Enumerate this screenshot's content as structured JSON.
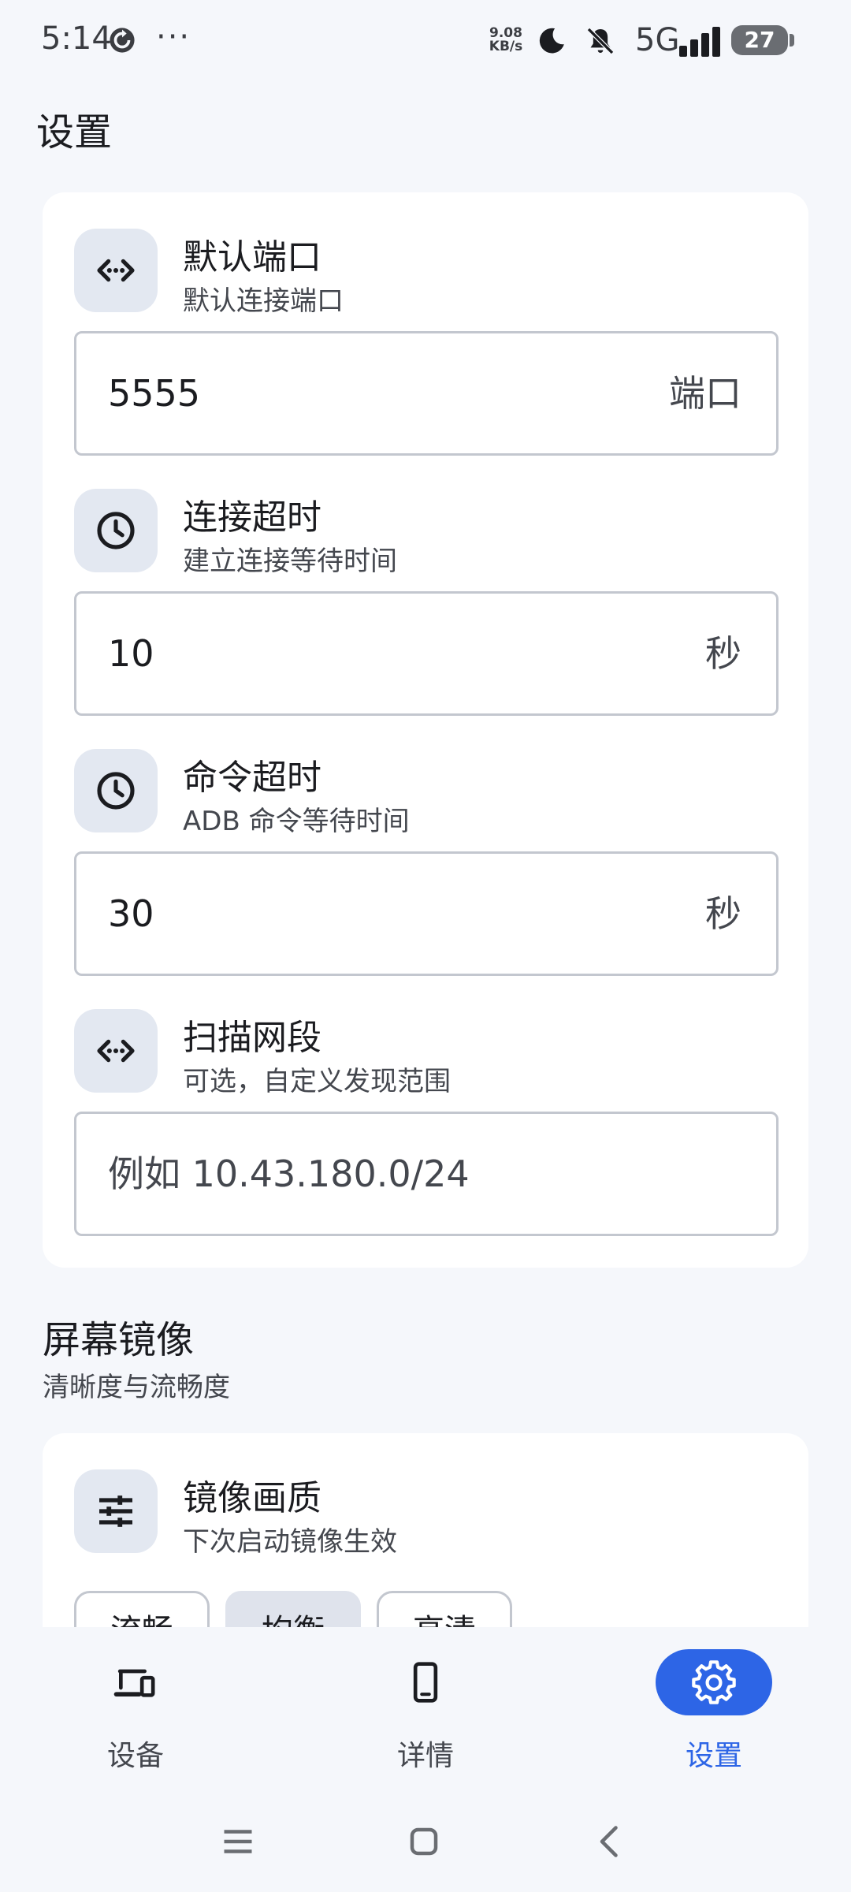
{
  "status_bar": {
    "time": "5:14",
    "more": "···",
    "speed_value": "9.08",
    "speed_unit": "KB/s",
    "network": "5G",
    "battery": "27"
  },
  "page": {
    "title": "设置"
  },
  "connection": {
    "default_port": {
      "title": "默认端口",
      "subtitle": "默认连接端口",
      "value": "5555",
      "suffix": "端口",
      "icon": "code-icon"
    },
    "connect_timeout": {
      "title": "连接超时",
      "subtitle": "建立连接等待时间",
      "value": "10",
      "suffix": "秒",
      "icon": "clock-icon"
    },
    "command_timeout": {
      "title": "命令超时",
      "subtitle": "ADB 命令等待时间",
      "value": "30",
      "suffix": "秒",
      "icon": "clock-icon"
    },
    "scan_range": {
      "title": "扫描网段",
      "subtitle": "可选，自定义发现范围",
      "value": "",
      "placeholder": "例如 10.43.180.0/24",
      "icon": "code-icon"
    }
  },
  "mirror_section": {
    "title": "屏幕镜像",
    "subtitle": "清晰度与流畅度",
    "quality": {
      "title": "镜像画质",
      "subtitle": "下次启动镜像生效",
      "icon": "tune-icon",
      "options": [
        "流畅",
        "均衡",
        "高清"
      ],
      "selected": "均衡"
    }
  },
  "bottom_nav": {
    "items": [
      {
        "label": "设备",
        "icon": "devices-icon",
        "active": false
      },
      {
        "label": "详情",
        "icon": "phone-icon",
        "active": false
      },
      {
        "label": "设置",
        "icon": "gear-icon",
        "active": true
      }
    ]
  },
  "colors": {
    "accent": "#2d65e6",
    "icon_tile": "#e3e8f1",
    "background": "#f5f7fb"
  }
}
